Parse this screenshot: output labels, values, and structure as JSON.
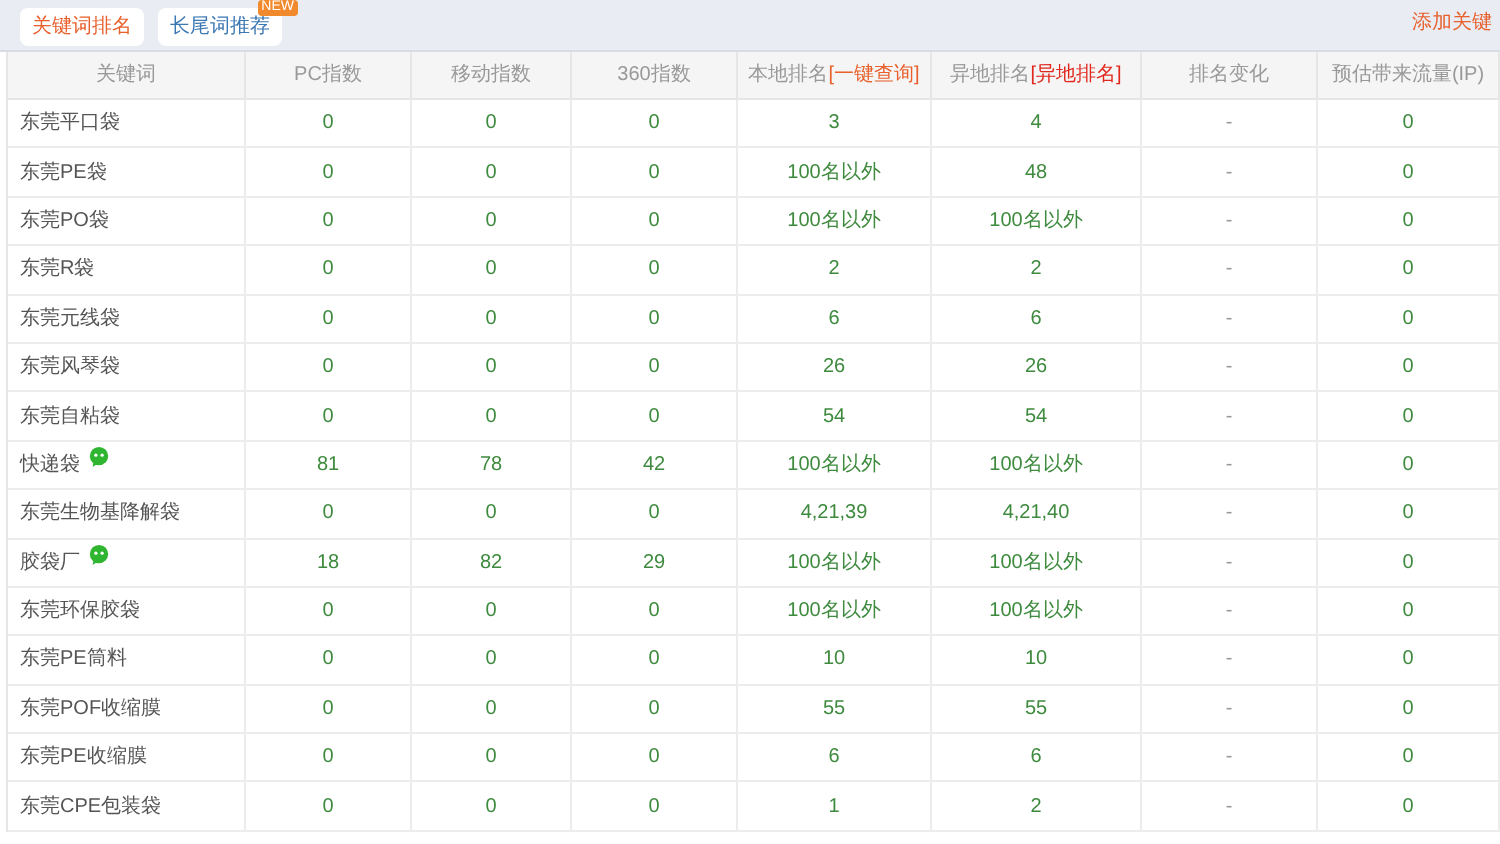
{
  "tabs": [
    {
      "label": "关键词排名",
      "selected": true
    },
    {
      "label": "长尾词推荐",
      "selected": false,
      "badge": "NEW"
    }
  ],
  "add_link": "添加关键",
  "table": {
    "columns": [
      {
        "label": "关键词"
      },
      {
        "label": "PC指数"
      },
      {
        "label": "移动指数"
      },
      {
        "label": "360指数"
      },
      {
        "label": "本地排名",
        "link": "[一键查询]",
        "kind": "query"
      },
      {
        "label": "异地排名",
        "link": "[异地排名]",
        "kind": "remote"
      },
      {
        "label": "排名变化"
      },
      {
        "label": "预估带来流量(IP)"
      }
    ],
    "rows": [
      {
        "wechat": false,
        "cells": [
          "东莞平口袋",
          "0",
          "0",
          "0",
          "3",
          "4",
          "-",
          "0"
        ]
      },
      {
        "wechat": false,
        "cells": [
          "东莞PE袋",
          "0",
          "0",
          "0",
          "100名以外",
          "48",
          "-",
          "0"
        ]
      },
      {
        "wechat": false,
        "cells": [
          "东莞PO袋",
          "0",
          "0",
          "0",
          "100名以外",
          "100名以外",
          "-",
          "0"
        ]
      },
      {
        "wechat": false,
        "cells": [
          "东莞R袋",
          "0",
          "0",
          "0",
          "2",
          "2",
          "-",
          "0"
        ]
      },
      {
        "wechat": false,
        "cells": [
          "东莞元线袋",
          "0",
          "0",
          "0",
          "6",
          "6",
          "-",
          "0"
        ]
      },
      {
        "wechat": false,
        "cells": [
          "东莞风琴袋",
          "0",
          "0",
          "0",
          "26",
          "26",
          "-",
          "0"
        ]
      },
      {
        "wechat": false,
        "cells": [
          "东莞自粘袋",
          "0",
          "0",
          "0",
          "54",
          "54",
          "-",
          "0"
        ]
      },
      {
        "wechat": true,
        "cells": [
          "快递袋",
          "81",
          "78",
          "42",
          "100名以外",
          "100名以外",
          "-",
          "0"
        ]
      },
      {
        "wechat": false,
        "cells": [
          "东莞生物基降解袋",
          "0",
          "0",
          "0",
          "4,21,39",
          "4,21,40",
          "-",
          "0"
        ]
      },
      {
        "wechat": true,
        "cells": [
          "胶袋厂",
          "18",
          "82",
          "29",
          "100名以外",
          "100名以外",
          "-",
          "0"
        ]
      },
      {
        "wechat": false,
        "cells": [
          "东莞环保胶袋",
          "0",
          "0",
          "0",
          "100名以外",
          "100名以外",
          "-",
          "0"
        ]
      },
      {
        "wechat": false,
        "cells": [
          "东莞PE筒料",
          "0",
          "0",
          "0",
          "10",
          "10",
          "-",
          "0"
        ]
      },
      {
        "wechat": false,
        "cells": [
          "东莞POF收缩膜",
          "0",
          "0",
          "0",
          "55",
          "55",
          "-",
          "0"
        ]
      },
      {
        "wechat": false,
        "cells": [
          "东莞PE收缩膜",
          "0",
          "0",
          "0",
          "6",
          "6",
          "-",
          "0"
        ]
      },
      {
        "wechat": false,
        "cells": [
          "东莞CPE包装袋",
          "0",
          "0",
          "0",
          "1",
          "2",
          "-",
          "0"
        ]
      }
    ]
  }
}
